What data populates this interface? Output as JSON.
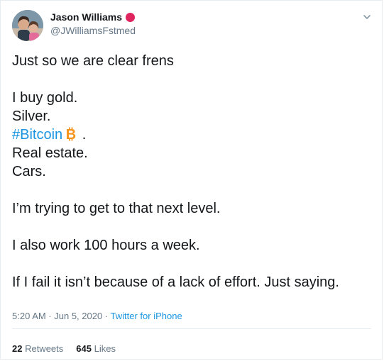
{
  "author": {
    "display_name": "Jason Williams",
    "handle": "@JWilliamsFstmed",
    "badge_color": "#e0245e"
  },
  "tweet": {
    "lines": [
      "Just so we are clear frens",
      "",
      "I buy gold.",
      "Silver.",
      "",
      "Real estate.",
      "Cars.",
      "",
      "I’m trying to get to that next level.",
      "",
      "I also work 100 hours a week.",
      "",
      "If I fail it isn’t because of a lack of effort.  Just saying."
    ],
    "hashtag": "#Bitcoin",
    "hashtag_suffix": " .",
    "hashtag_icon": "bitcoin-icon",
    "link_color": "#1b95e0"
  },
  "meta": {
    "time_date": "5:20 AM · Jun 5, 2020 · ",
    "source": "Twitter for iPhone"
  },
  "stats": {
    "retweets_count": "22",
    "retweets_label": " Retweets",
    "likes_count": "645",
    "likes_label": " Likes"
  },
  "icons": {
    "menu": "chevron-down-icon"
  }
}
